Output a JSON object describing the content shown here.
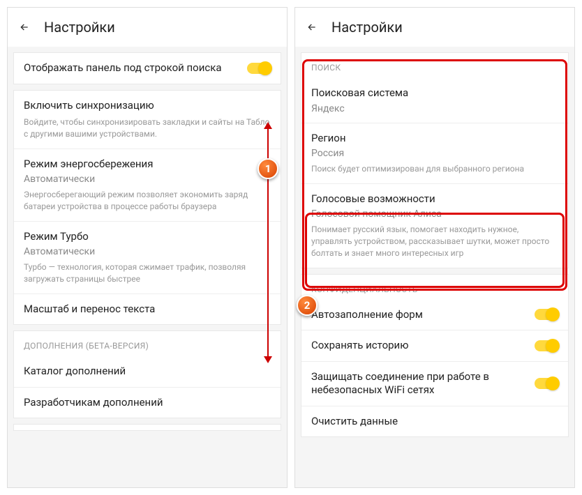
{
  "left": {
    "title": "Настройки",
    "panel_toggle": "Отображать панель под строкой поиска",
    "sync_title": "Включить синхронизацию",
    "sync_desc": "Войдите, чтобы синхронизировать закладки и сайты на Табло с другими вашими устройствами.",
    "power_title": "Режим энергосбережения",
    "power_value": "Автоматически",
    "power_desc": "Энергосберегающий режим позволяет экономить заряд батареи устройства в процессе работы браузера",
    "turbo_title": "Режим Турбо",
    "turbo_value": "Автоматически",
    "turbo_desc": "Турбо — технология, которая сжимает трафик, позволяя загружать страницы быстрее",
    "scale_title": "Масштаб и перенос текста",
    "addons_section": "ДОПОЛНЕНИЯ (БЕТА-ВЕРСИЯ)",
    "catalog": "Каталог дополнений",
    "developers": "Разработчикам дополнений"
  },
  "right": {
    "title": "Настройки",
    "search_section": "ПОИСК",
    "engine_title": "Поисковая система",
    "engine_value": "Яндекс",
    "region_title": "Регион",
    "region_value": "Россия",
    "region_desc": "Поиск будет оптимизирован для выбранного региона",
    "voice_title": "Голосовые возможности",
    "voice_value": "Голосовой помощник Алиса",
    "voice_desc": "Понимает русский язык, помогает находить нужное, управлять устройством, рассказывает шутки, может просто болтать и знает много интересных игр",
    "privacy_section": "КОНФИДЕНЦИАЛЬНОСТЬ",
    "autofill": "Автозаполнение форм",
    "history": "Сохранять историю",
    "wifi": "Защищать соединение при работе в небезопасных WiFi сетях",
    "clear": "Очистить данные"
  },
  "markers": {
    "one": "1",
    "two": "2"
  }
}
